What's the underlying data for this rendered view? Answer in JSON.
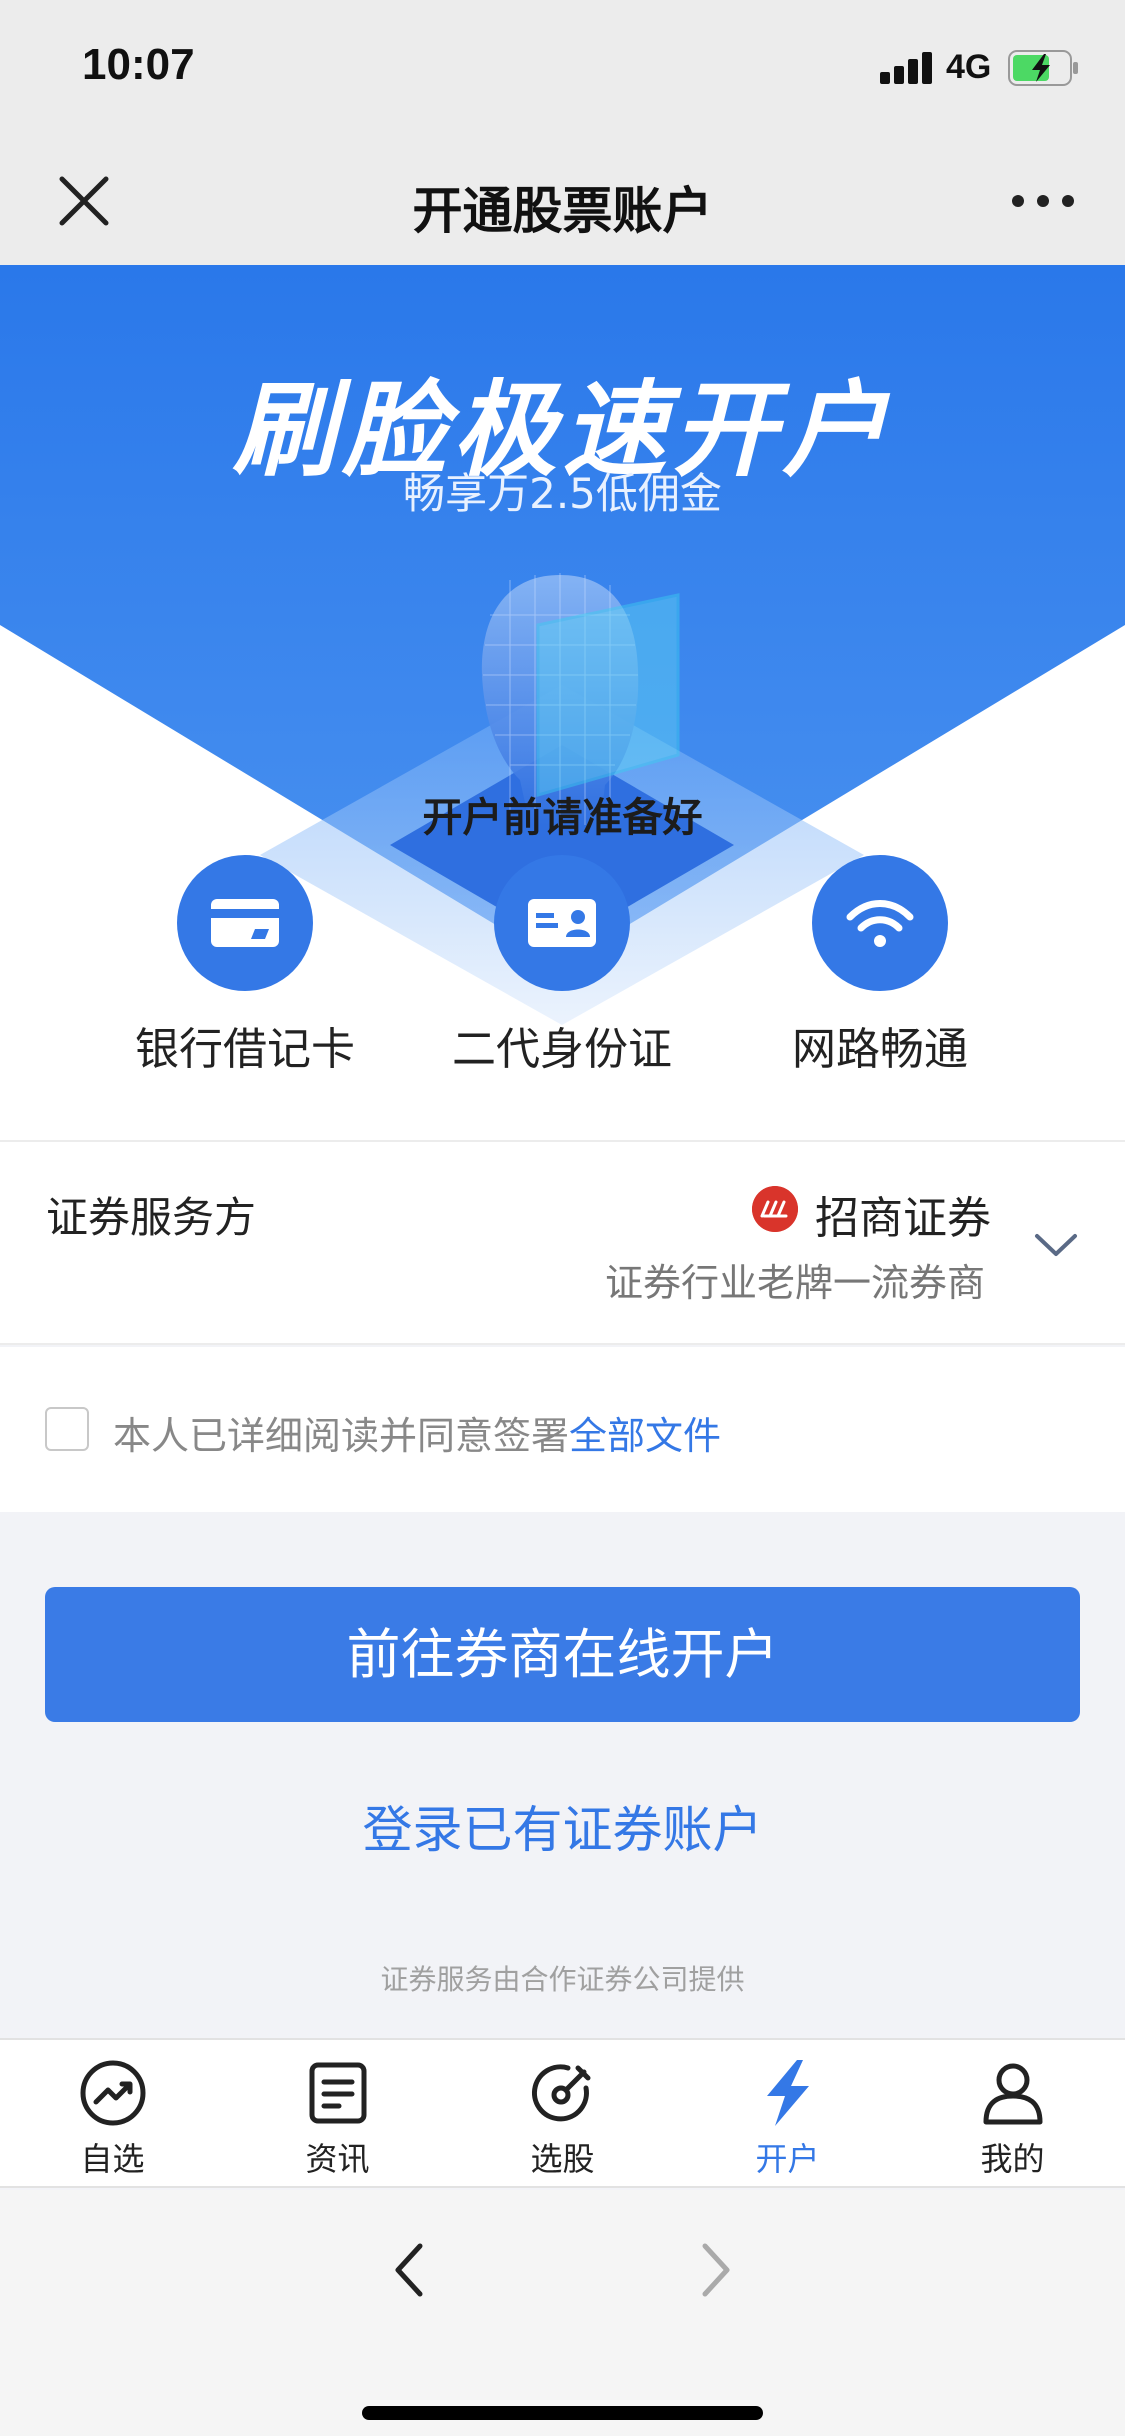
{
  "status_bar": {
    "time": "10:07",
    "network": "4G"
  },
  "nav": {
    "title": "开通股票账户"
  },
  "hero": {
    "title": "刷脸极速开户",
    "subtitle": "畅享万2.5低佣金",
    "prepare_title": "开户前请准备好",
    "requirements": [
      {
        "label": "银行借记卡",
        "icon": "bank-card-icon"
      },
      {
        "label": "二代身份证",
        "icon": "id-card-icon"
      },
      {
        "label": "网路畅通",
        "icon": "wifi-icon"
      }
    ]
  },
  "service": {
    "label": "证券服务方",
    "broker_name": "招商证券",
    "broker_desc": "证券行业老牌一流券商"
  },
  "agreement": {
    "text": "本人已详细阅读并同意签署",
    "link": "全部文件"
  },
  "actions": {
    "primary": "前往券商在线开户",
    "login": "登录已有证券账户",
    "footer_note": "证券服务由合作证券公司提供"
  },
  "tabs": [
    {
      "label": "自选",
      "icon": "trend-icon",
      "active": false
    },
    {
      "label": "资讯",
      "icon": "news-icon",
      "active": false
    },
    {
      "label": "选股",
      "icon": "stock-picker-icon",
      "active": false
    },
    {
      "label": "开户",
      "icon": "lightning-icon",
      "active": true
    },
    {
      "label": "我的",
      "icon": "user-icon",
      "active": false
    }
  ],
  "colors": {
    "accent": "#3478e6",
    "hero_blue": "#2a7ae8",
    "broker_red": "#d9342b"
  }
}
